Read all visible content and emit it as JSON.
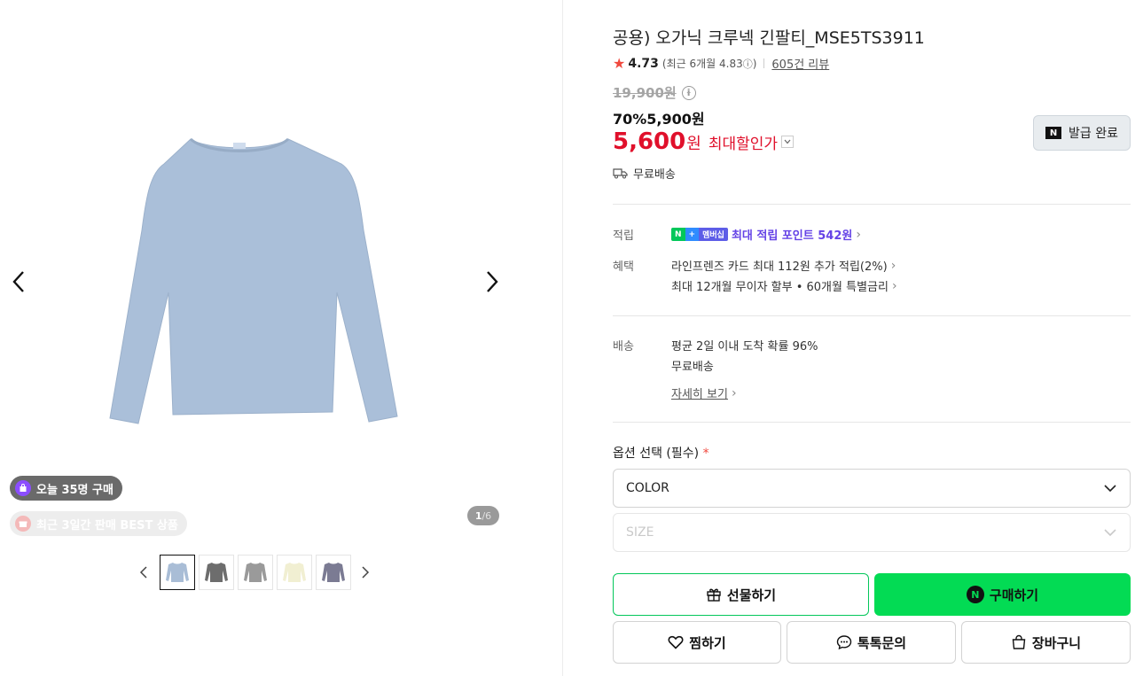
{
  "gallery": {
    "counter_current": "1",
    "counter_total": "/6",
    "today_badge": "오늘 35명 구매",
    "best_badge": "최근 3일간 판매 BEST 상품",
    "thumbnail_colors": [
      "#a9bdd6",
      "#6d6d6d",
      "#9a9a9a",
      "#f1efd2",
      "#7b7b93"
    ],
    "main_color": "#aabfd9"
  },
  "product": {
    "title": "공용) 오가닉 크루넥 긴팔티_MSE5TS3911",
    "rating": "4.73",
    "recent_rating": "(최근 6개월 4.83",
    "recent_rating_close": ")",
    "review_count": "605건 리뷰",
    "original_price": "19,900원",
    "discount_rate": "70%",
    "sale_price": "5,900원",
    "max_price": "5,600",
    "max_price_unit": "원",
    "max_price_label": "최대할인가",
    "coupon_button": "발급 완료",
    "shipping": "무료배송"
  },
  "benefits": {
    "points_label": "적립",
    "points_tag_n": "N",
    "points_tag_plus": "+",
    "points_tag_member": "멤버십",
    "points_text": "최대 적립 포인트 542원",
    "benefit_label": "혜택",
    "benefit_lines": [
      "라인프렌즈 카드 최대 112원 추가 적립(2%)",
      "최대 12개월 무이자 할부 • 60개월 특별금리"
    ]
  },
  "delivery": {
    "label": "배송",
    "line1": "평균 2일 이내 도착 확률 96%",
    "line2": "무료배송",
    "detail_link": "자세히 보기"
  },
  "options": {
    "label": "옵션 선택 (필수)",
    "required_mark": "*",
    "color_select": "COLOR",
    "size_select": "SIZE"
  },
  "actions": {
    "gift": "선물하기",
    "buy": "구매하기",
    "wishlist": "찜하기",
    "talk": "톡톡문의",
    "cart": "장바구니"
  },
  "colors": {
    "accent_green": "#03db54",
    "price_red": "#e0102b",
    "point_purple": "#6442e6"
  }
}
